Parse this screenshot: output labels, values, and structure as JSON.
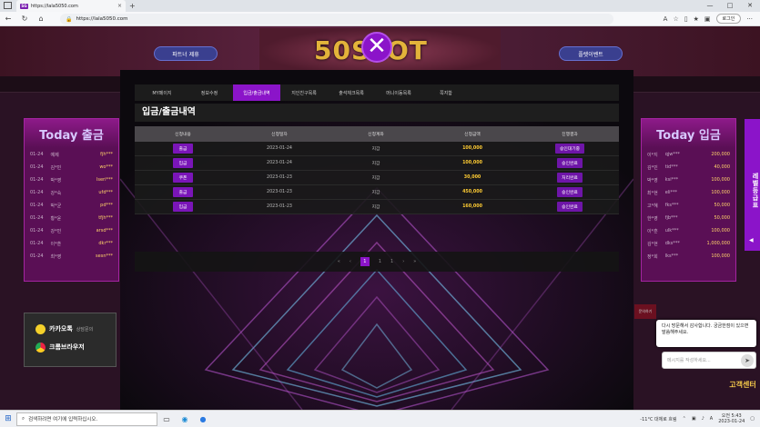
{
  "browser": {
    "tab_favicon": "SG",
    "tab_title": "https://lala5050.com",
    "tab_close": "×",
    "new_tab": "+",
    "url": "https://lala5050.com",
    "login_label": "로그인",
    "more": "···"
  },
  "site": {
    "left_button": "파트너 제휴",
    "right_button": "플렛이벤트",
    "logo": "50SLOT",
    "close_symbol": "✕",
    "left_panel": {
      "title": "Today 출금",
      "rows": [
        {
          "date": "01-24",
          "id": "예제",
          "amt": "fjh***"
        },
        {
          "date": "01-24",
          "id": "김*민",
          "amt": "wo***"
        },
        {
          "date": "01-24",
          "id": "박*영",
          "amt": "lseri***"
        },
        {
          "date": "01-24",
          "id": "강*숙",
          "amt": "ufd***"
        },
        {
          "date": "01-24",
          "id": "박*균",
          "amt": "pd***"
        },
        {
          "date": "01-24",
          "id": "황*윤",
          "amt": "tfjh***"
        },
        {
          "date": "01-24",
          "id": "강*민",
          "amt": "arsd***"
        },
        {
          "date": "01-24",
          "id": "이*훈",
          "amt": "dkr***"
        },
        {
          "date": "01-24",
          "id": "최*영",
          "amt": "sesn***"
        }
      ]
    },
    "right_panel": {
      "title": "Today 입금",
      "rows": [
        {
          "id": "이*지",
          "user": "qjw***",
          "amt": "200,000"
        },
        {
          "id": "김*민",
          "user": "tid***",
          "amt": "40,000"
        },
        {
          "id": "박*영",
          "user": "ksi***",
          "amt": "100,000"
        },
        {
          "id": "최*현",
          "user": "eli***",
          "amt": "100,000"
        },
        {
          "id": "고*혜",
          "user": "fks***",
          "amt": "50,000"
        },
        {
          "id": "한*영",
          "user": "fjb***",
          "amt": "50,000"
        },
        {
          "id": "이*훈",
          "user": "ulk***",
          "amt": "100,000"
        },
        {
          "id": "김*현",
          "user": "dks***",
          "amt": "1,000,000"
        },
        {
          "id": "정*희",
          "user": "lks***",
          "amt": "100,000"
        }
      ]
    },
    "left_box": {
      "kakao": "카카오톡",
      "kakao_sub": "상담문의",
      "chrome": "크롬브라우저"
    },
    "right_tab": "레벨등급표",
    "right_tab_arrow": "◀"
  },
  "modal": {
    "tabs": [
      "MY페이지",
      "정보수정",
      "입금/출금내역",
      "지인친구목록",
      "출석체크목록",
      "머니이동목록",
      "쪽지함"
    ],
    "active_tab": 2,
    "title": "입금/출금내역",
    "columns": [
      "신청내용",
      "신청일자",
      "신청계좌",
      "신청금액",
      "진행결과"
    ],
    "rows": [
      {
        "type": "출금",
        "date": "2023-01-24",
        "account": "지갑",
        "amount": "100,000",
        "status": "승인대기중"
      },
      {
        "type": "입금",
        "date": "2023-01-24",
        "account": "지갑",
        "amount": "100,000",
        "status": "승인완료"
      },
      {
        "type": "쿠폰",
        "date": "2023-01-23",
        "account": "지갑",
        "amount": "30,000",
        "status": "처리완료"
      },
      {
        "type": "출금",
        "date": "2023-01-23",
        "account": "지갑",
        "amount": "450,000",
        "status": "승인완료"
      },
      {
        "type": "입금",
        "date": "2023-01-23",
        "account": "지갑",
        "amount": "160,000",
        "status": "승인완료"
      }
    ],
    "pager": {
      "first": "«",
      "prev": "‹",
      "current": "1",
      "p2": "1",
      "p3": "1",
      "next": "›",
      "last": "»"
    }
  },
  "chat": {
    "message": "다시 방문해서 감사합니다. 궁금한점이 있으면 말씀해주세요.",
    "placeholder": "메시지를 작성하세요...",
    "send": "➤",
    "side_label": "문의하기",
    "logo": "고객센터"
  },
  "taskbar": {
    "search_placeholder": "검색하려면 여기에 입력하십시오.",
    "weather": "-11°C 대체로 흐림",
    "time": "오전 5:43",
    "date": "2023-01-24"
  }
}
